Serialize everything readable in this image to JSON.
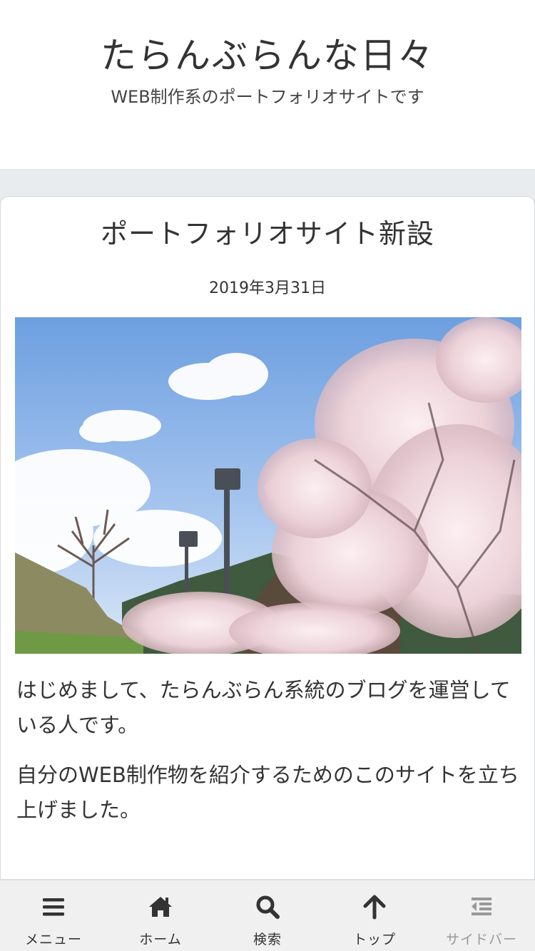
{
  "header": {
    "site_title": "たらんぶらんな日々",
    "tagline": "WEB制作系のポートフォリオサイトです"
  },
  "article": {
    "title": "ポートフォリオサイト新設",
    "date": "2019年3月31日",
    "paragraphs": [
      "はじめまして、たらんぶらん系統のブログを運営している人です。",
      "自分のWEB制作物を紹介するためのこのサイトを立ち上げました。"
    ]
  },
  "bottom_nav": {
    "items": [
      {
        "label": "メニュー",
        "icon": "hamburger-menu-icon"
      },
      {
        "label": "ホーム",
        "icon": "home-icon"
      },
      {
        "label": "検索",
        "icon": "search-icon"
      },
      {
        "label": "トップ",
        "icon": "arrow-up-icon"
      },
      {
        "label": "サイドバー",
        "icon": "sidebar-outdent-icon"
      }
    ]
  },
  "colors": {
    "background": "#e8ecef",
    "card": "#ffffff",
    "text": "#333333",
    "nav_background": "#f0f0f0",
    "nav_disabled": "#999999"
  }
}
